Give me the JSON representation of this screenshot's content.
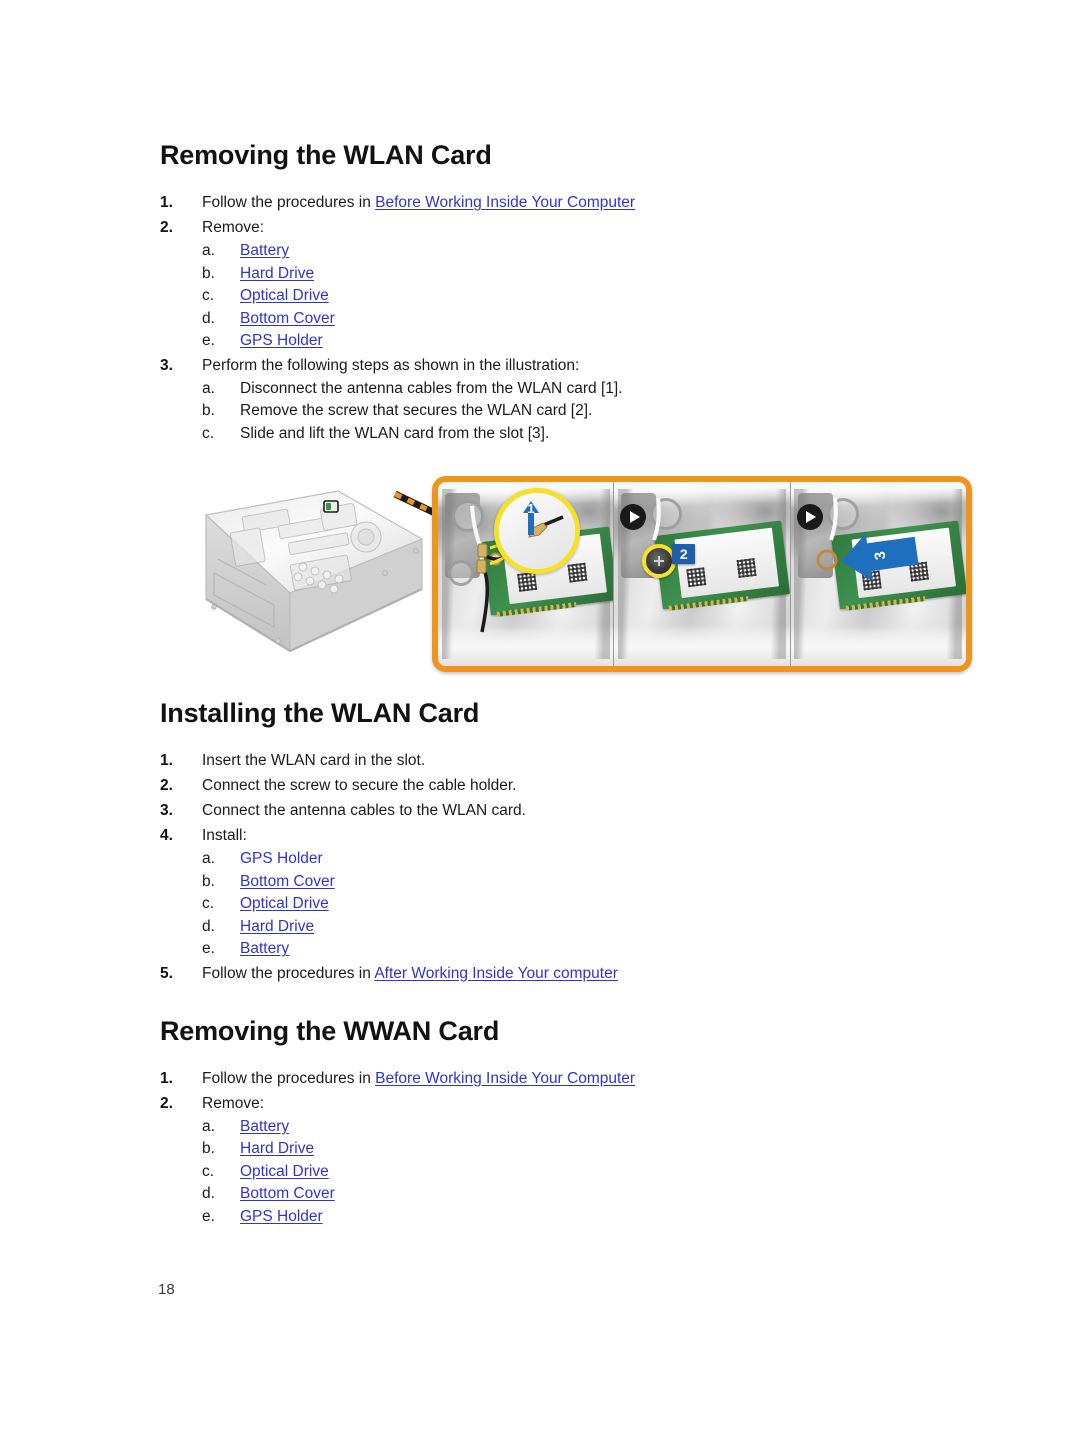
{
  "page": {
    "number": "18"
  },
  "sections": [
    {
      "id": "removing-wlan",
      "heading": "Removing the WLAN Card",
      "steps": [
        {
          "num": "1.",
          "prefix": "Follow the procedures in ",
          "link": "Before Working Inside Your Computer",
          "suffix": ""
        },
        {
          "num": "2.",
          "prefix": "Remove:",
          "link": "",
          "suffix": "",
          "substeps": [
            {
              "alpha": "a.",
              "link": "Battery"
            },
            {
              "alpha": "b.",
              "link": "Hard Drive"
            },
            {
              "alpha": "c.",
              "link": "Optical Drive"
            },
            {
              "alpha": "d.",
              "link": "Bottom Cover"
            },
            {
              "alpha": "e.",
              "link": "GPS Holder"
            }
          ]
        },
        {
          "num": "3.",
          "prefix": "Perform the following steps as shown in the illustration:",
          "link": "",
          "suffix": "",
          "substeps": [
            {
              "alpha": "a.",
              "text": "Disconnect the antenna cables from the WLAN card [1]."
            },
            {
              "alpha": "b.",
              "text": "Remove the screw that secures the WLAN card [2]."
            },
            {
              "alpha": "c.",
              "text": "Slide and lift the WLAN card from the slot [3]."
            }
          ]
        }
      ]
    },
    {
      "id": "installing-wlan",
      "heading": "Installing the WLAN Card",
      "steps": [
        {
          "num": "1.",
          "prefix": "Insert the WLAN card in the slot.",
          "link": "",
          "suffix": ""
        },
        {
          "num": "2.",
          "prefix": "Connect the screw to secure the cable holder.",
          "link": "",
          "suffix": ""
        },
        {
          "num": "3.",
          "prefix": "Connect the antenna cables to the WLAN card.",
          "link": "",
          "suffix": ""
        },
        {
          "num": "4.",
          "prefix": "Install:",
          "link": "",
          "suffix": "",
          "substeps": [
            {
              "alpha": "a.",
              "link": "GPS Holder"
            },
            {
              "alpha": "b.",
              "link": "Bottom Cover"
            },
            {
              "alpha": "c.",
              "link": "Optical Drive"
            },
            {
              "alpha": "d.",
              "link": "Hard Drive"
            },
            {
              "alpha": "e.",
              "link": "Battery"
            }
          ]
        },
        {
          "num": "5.",
          "prefix": "Follow the procedures in ",
          "link": "After Working Inside Your computer",
          "suffix": ""
        }
      ]
    },
    {
      "id": "removing-wwan",
      "heading": "Removing the WWAN Card",
      "steps": [
        {
          "num": "1.",
          "prefix": "Follow the procedures in ",
          "link": "Before Working Inside Your Computer",
          "suffix": ""
        },
        {
          "num": "2.",
          "prefix": "Remove:",
          "link": "",
          "suffix": "",
          "substeps": [
            {
              "alpha": "a.",
              "link": "Battery"
            },
            {
              "alpha": "b.",
              "link": "Hard Drive"
            },
            {
              "alpha": "c.",
              "link": "Optical Drive"
            },
            {
              "alpha": "d.",
              "link": "Bottom Cover"
            },
            {
              "alpha": "e.",
              "link": "GPS Holder"
            }
          ]
        }
      ]
    }
  ],
  "figure": {
    "alt": "Exploded view of laptop base with WLAN card removal steps",
    "frame_color": "#F0941E",
    "callouts": [
      {
        "id": "1",
        "label": "1",
        "description": "Disconnect antenna cables - blue up arrow in yellow magnifier"
      },
      {
        "id": "2",
        "label": "2",
        "description": "Remove screw - yellow highlighted screw with blue badge"
      },
      {
        "id": "3",
        "label": "3",
        "description": "Slide and lift card - blue left arrow"
      }
    ],
    "panel_count": "3",
    "separator_icon": "play-arrow-icon"
  },
  "colors": {
    "link": "#3333CC",
    "heading": "#121212",
    "body": "#1B1B1B",
    "frame_orange": "#F0941E",
    "callout_blue": "#1F5FA9",
    "highlight_yellow": "#F5E02A"
  }
}
